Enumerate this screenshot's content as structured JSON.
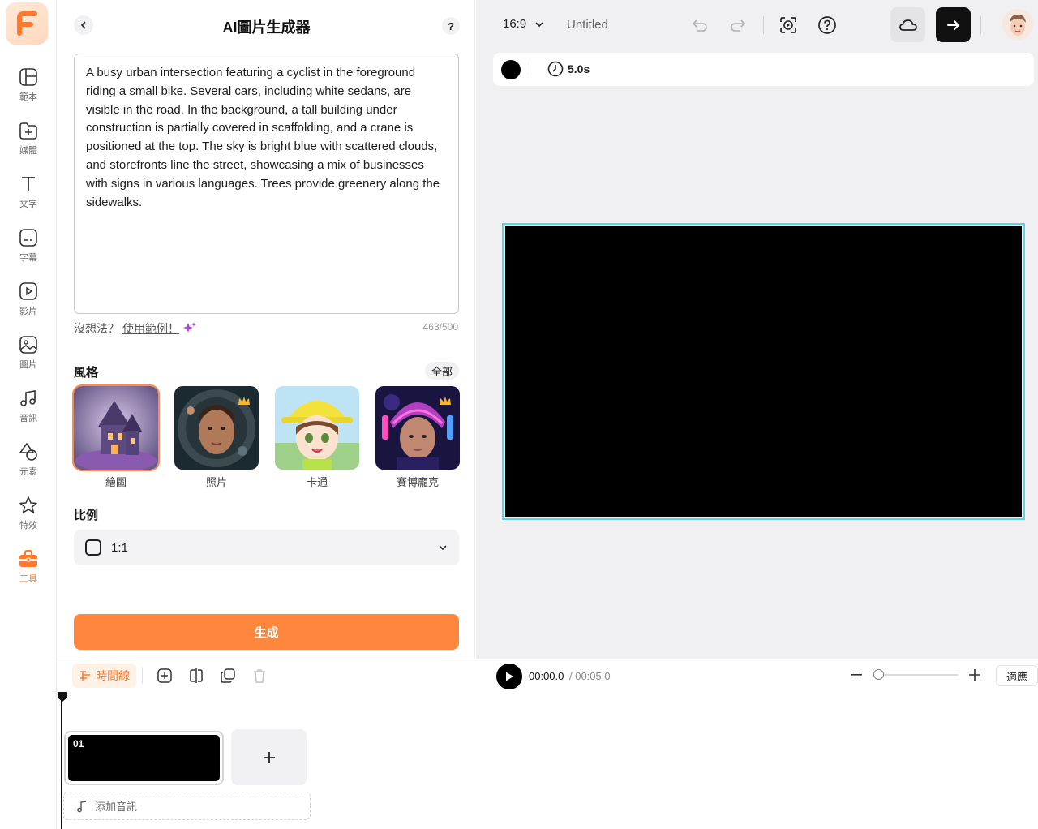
{
  "rail": {
    "items": [
      {
        "label": "範本"
      },
      {
        "label": "媒體"
      },
      {
        "label": "文字"
      },
      {
        "label": "字幕"
      },
      {
        "label": "影片"
      },
      {
        "label": "圖片"
      },
      {
        "label": "音訊"
      },
      {
        "label": "元素"
      },
      {
        "label": "特效"
      },
      {
        "label": "工具"
      }
    ],
    "active_index": 9,
    "accent": "#ff7a2f"
  },
  "panel": {
    "title": "AI圖片生成器",
    "help": "?",
    "prompt": "A busy urban intersection featuring a cyclist in the foreground riding a small bike. Several cars, including white sedans, are visible in the road. In the background, a tall building under construction is partially covered in scaffolding, and a crane is positioned at the top. The sky is bright blue with scattered clouds, and storefronts line the street, showcasing a mix of businesses with signs in various languages. Trees provide greenery along the sidewalks.",
    "hint_prefix": "沒想法？",
    "hint_link": "使用範例！",
    "char_count": "463/500",
    "style_label": "風格",
    "all_label": "全部",
    "styles": [
      {
        "name": "繪圖",
        "selected": true,
        "premium": false
      },
      {
        "name": "照片",
        "selected": false,
        "premium": true
      },
      {
        "name": "卡通",
        "selected": false,
        "premium": false
      },
      {
        "name": "賽博龐克",
        "selected": false,
        "premium": true
      }
    ],
    "ratio_label": "比例",
    "ratio_value": "1:1",
    "generate_label": "生成",
    "generate_color": "#ff863d"
  },
  "topbar": {
    "aspect": "16:9",
    "doc_title": "Untitled"
  },
  "scene": {
    "background_color": "#000000",
    "duration": "5.0s"
  },
  "timeline": {
    "tab_label": "時間線",
    "current_time": "00:00.0",
    "total_time": " / 00:05.0",
    "fit_label": "適應",
    "clips": [
      {
        "number": "01"
      }
    ],
    "add_audio_label": "添加音訊"
  }
}
